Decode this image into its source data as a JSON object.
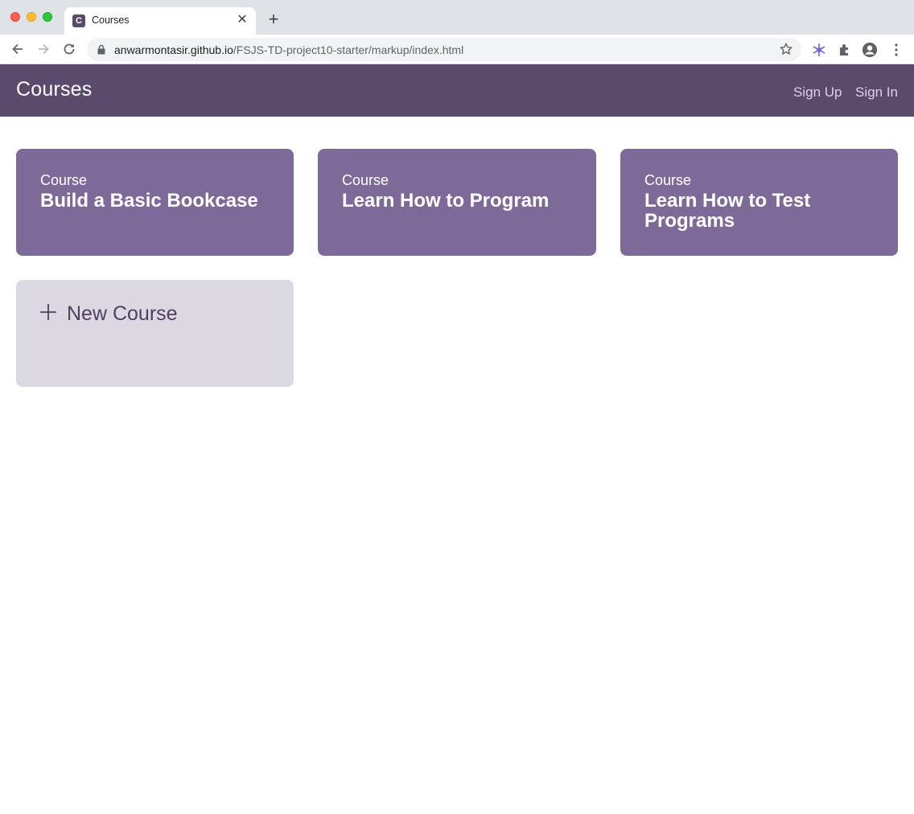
{
  "browser": {
    "tab_title": "Courses",
    "tab_favicon_letter": "C",
    "close_glyph": "✕",
    "new_tab_glyph": "+",
    "url_host": "anwarmontasir.github.io",
    "url_path": "/FSJS-TD-project10-starter/markup/index.html"
  },
  "header": {
    "title": "Courses",
    "sign_up": "Sign Up",
    "sign_in": "Sign In"
  },
  "courses": [
    {
      "label": "Course",
      "title": "Build a Basic Bookcase"
    },
    {
      "label": "Course",
      "title": "Learn How to Program"
    },
    {
      "label": "Course",
      "title": "Learn How to Test Programs"
    }
  ],
  "new_course": {
    "label": "New Course"
  },
  "colors": {
    "header": "#5a4a6c",
    "course_card": "#7e6a99",
    "new_card": "#dcd8e2"
  }
}
